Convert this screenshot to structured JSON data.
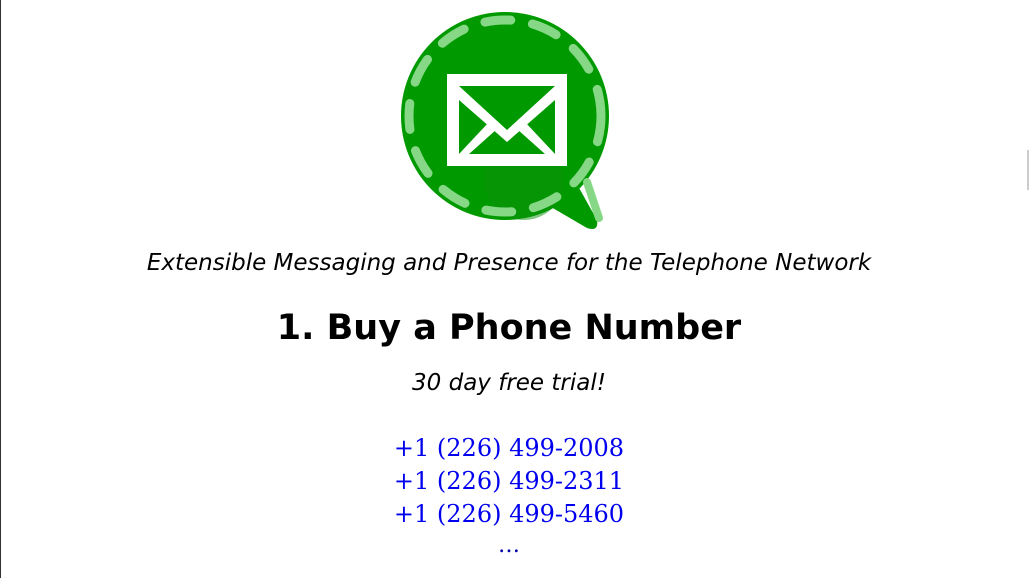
{
  "logo": {
    "icon": "envelope-chat-bubble-icon",
    "colors": {
      "bubble": "#009a00",
      "dash": "#80d080",
      "envelope": "#ffffff"
    }
  },
  "tagline": "Extensible Messaging and Presence for the Telephone Network",
  "step": {
    "heading": "1. Buy a Phone Number",
    "subtitle": "30 day free trial!"
  },
  "phone_numbers": [
    "+1 (226) 499-2008",
    "+1 (226) 499-2311",
    "+1 (226) 499-5460"
  ],
  "more_label": "…",
  "colors": {
    "link": "#0000ee"
  }
}
